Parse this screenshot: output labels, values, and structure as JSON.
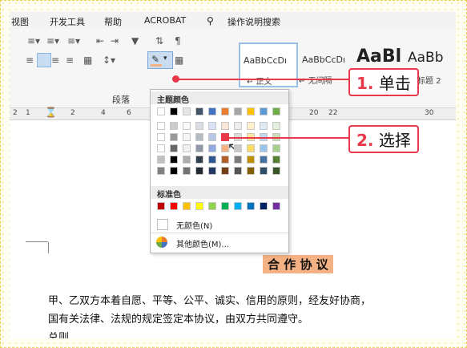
{
  "tabs": [
    "视图",
    "开发工具",
    "帮助",
    "ACROBAT",
    "操作说明搜索"
  ],
  "icons": {
    "search": "lightbulb-icon",
    "bullets": "bullet-list-icon",
    "numbering": "numbered-list-icon",
    "multilevel": "multilevel-list-icon",
    "shading": "shading-icon"
  },
  "ribbon": {
    "group_label": "段落",
    "styles": [
      {
        "preview": "AaBbCcDı",
        "label": "↵ 正文"
      },
      {
        "preview": "AaBbCcDı",
        "label": "↵ 无间隔"
      },
      {
        "preview": "AaBl",
        "label": ""
      },
      {
        "preview": "AaBb",
        "label": "标题 2"
      }
    ]
  },
  "ruler": {
    "ticks_left": [
      "2",
      "1",
      "2",
      "4",
      "6"
    ],
    "ticks_right": [
      "20",
      "22",
      "30"
    ]
  },
  "popup": {
    "theme_title": "主题颜色",
    "standard_title": "标准色",
    "no_color": "无颜色(N)",
    "more_colors": "其他颜色(M)...",
    "theme_colors": [
      "#ffffff",
      "#000000",
      "#e7e6e6",
      "#44546a",
      "#4472c4",
      "#ed7d31",
      "#a5a5a5",
      "#ffc000",
      "#5b9bd5",
      "#70ad47"
    ],
    "standard_colors": [
      "#c00000",
      "#ff0000",
      "#ffc000",
      "#ffff00",
      "#92d050",
      "#00b050",
      "#00b0f0",
      "#0070c0",
      "#002060",
      "#7030a0"
    ],
    "selected_color": "#f4b183"
  },
  "callouts": {
    "step1_num": "1.",
    "step1_text": "单击",
    "step2_num": "2.",
    "step2_text": "选择"
  },
  "document": {
    "title": "合 作 协 议",
    "para1": "甲、乙双方本着自愿、平等、公平、诚实、信用的原则，经友好协商，",
    "para2": "国有关法律、法规的规定签定本协议，由双方共同遵守。",
    "section": "总则",
    "title_highlight": "#f4b183"
  }
}
